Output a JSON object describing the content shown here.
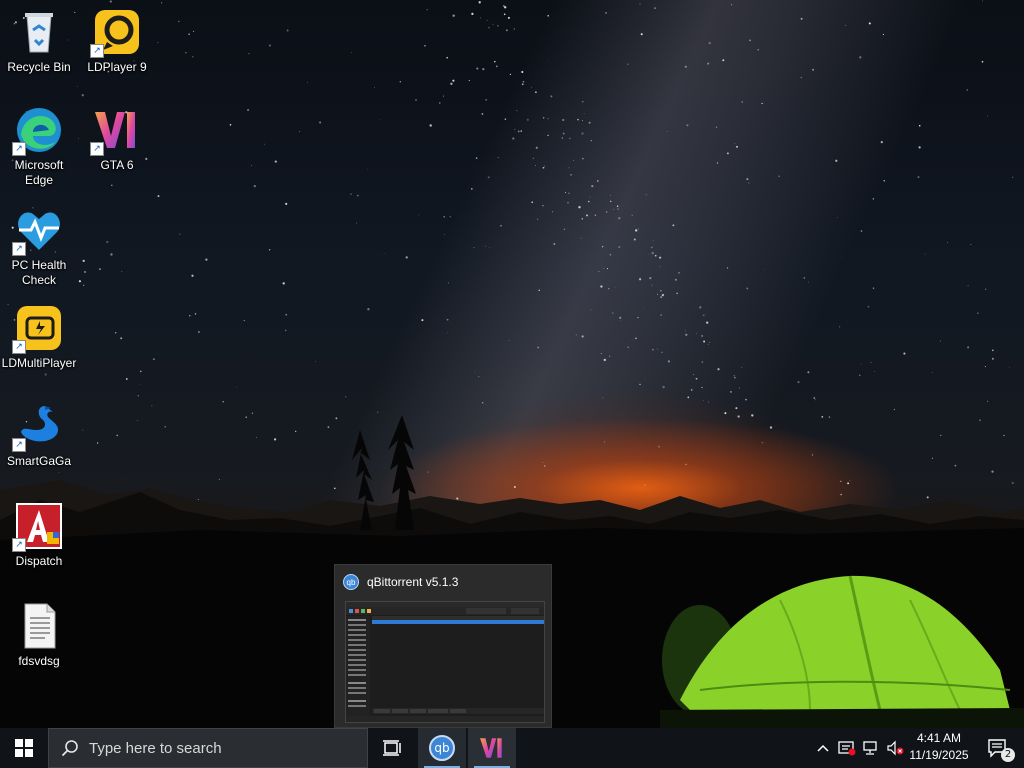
{
  "desktop": {
    "icons": [
      {
        "label": "Recycle Bin"
      },
      {
        "label": "LDPlayer 9"
      },
      {
        "label": "Microsoft Edge"
      },
      {
        "label": "GTA 6"
      },
      {
        "label": "PC Health Check"
      },
      {
        "label": "LDMultiPlayer"
      },
      {
        "label": "SmartGaGa"
      },
      {
        "label": "Dispatch"
      },
      {
        "label": "fdsvdsg"
      }
    ]
  },
  "preview": {
    "title": "qBittorrent v5.1.3",
    "app_icon_text": "qb"
  },
  "taskbar": {
    "search_placeholder": "Type here to search",
    "qb_icon_text": "qb",
    "time": "4:41 AM",
    "date": "11/19/2025",
    "notification_count": "2"
  },
  "colors": {
    "taskbar_bg": "#101418",
    "accent": "#79b0e8"
  }
}
